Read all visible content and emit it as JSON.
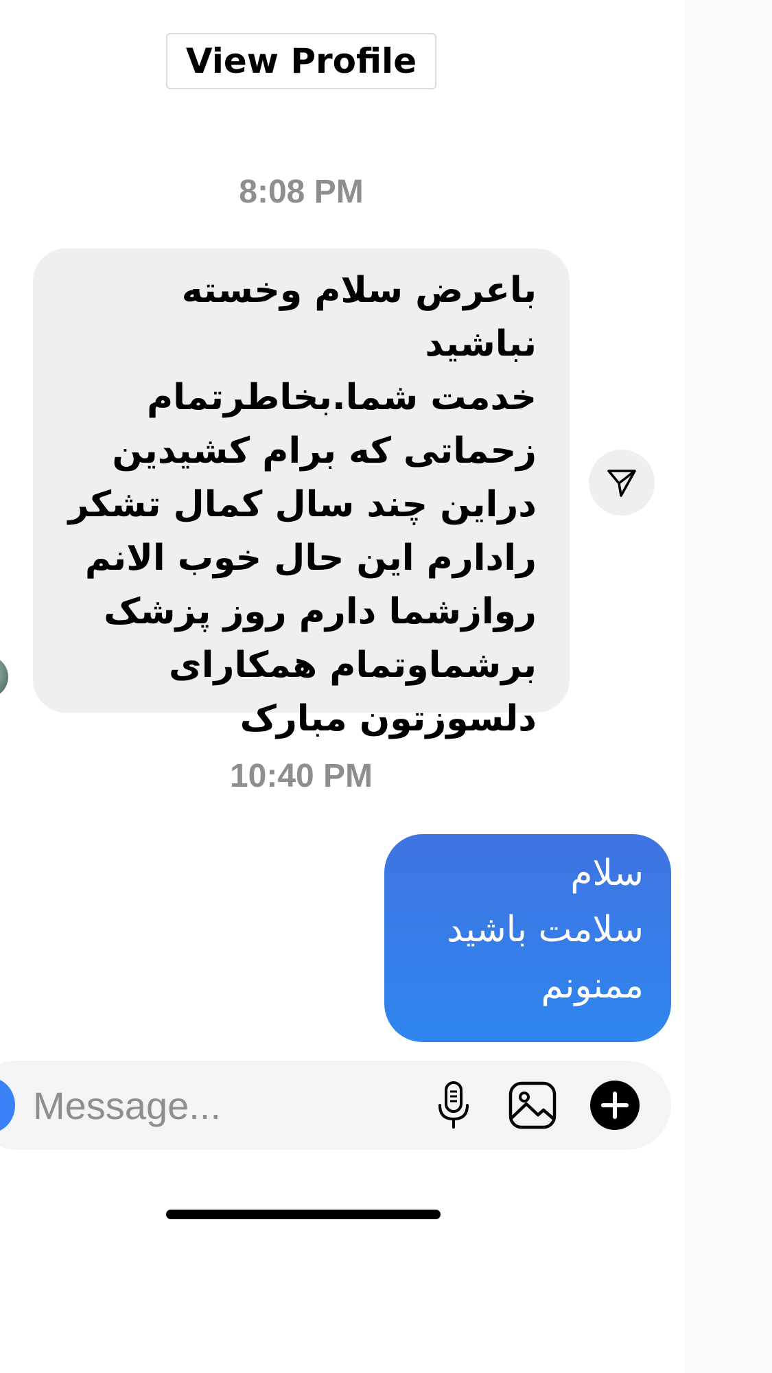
{
  "header": {
    "view_profile_label": "View Profile"
  },
  "messages": [
    {
      "timestamp": "8:08 PM",
      "direction": "incoming",
      "text": "باعرض سلام وخسته نباشید\nخدمت شما.بخاطرتمام\nزحماتی که برام کشیدین\nدراین چند سال کمال تشکر\nرادارم این حال خوب الانم\nروازشما دارم روز پزشک\nبرشماوتمام همکارای\nدلسوزتون مبارک"
    },
    {
      "timestamp": "10:40 PM",
      "direction": "outgoing",
      "text": "سلام\nسلامت باشید\nممنونم"
    }
  ],
  "composer": {
    "placeholder": "Message...",
    "icons": [
      "camera-icon",
      "microphone-icon",
      "gallery-icon",
      "plus-icon"
    ]
  },
  "icons": {
    "share": "paper-plane-icon"
  },
  "colors": {
    "incoming_bubble": "#efefef",
    "outgoing_bubble_top": "#3f73e2",
    "outgoing_bubble_bottom": "#2f86ee",
    "timestamp": "#8e8e8e",
    "composer_bg": "#f4f4f6"
  }
}
